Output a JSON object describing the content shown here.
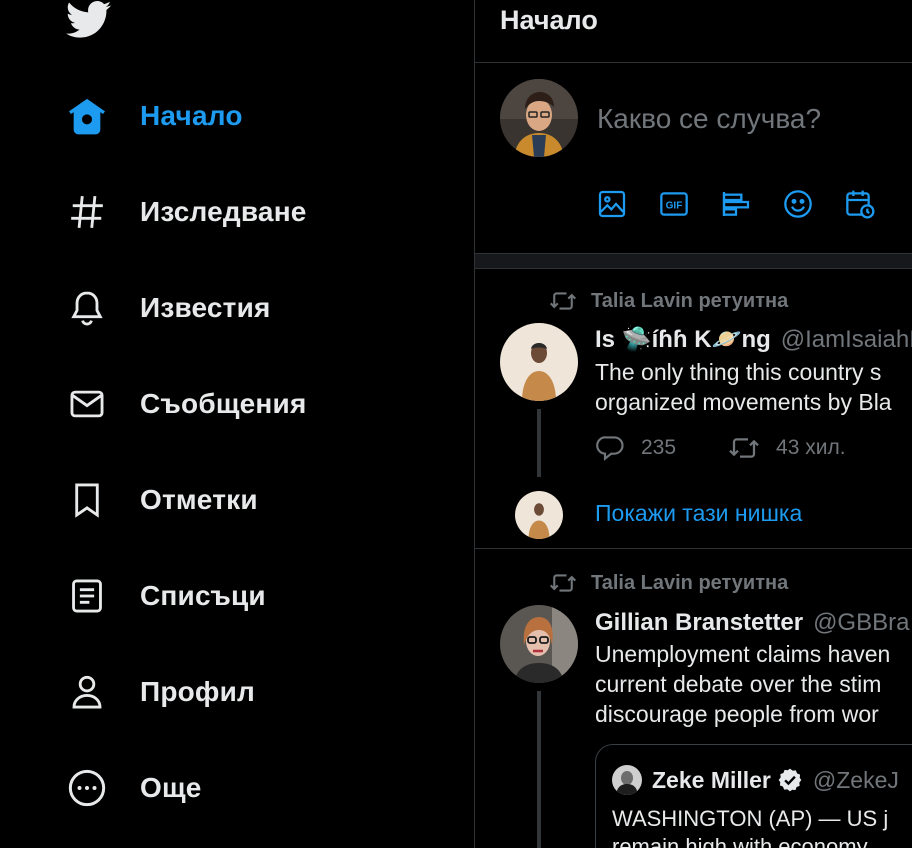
{
  "sidebar": {
    "logo": "twitter-bird-logo",
    "items": [
      {
        "label": "Начало",
        "icon": "home-icon",
        "active": true
      },
      {
        "label": "Изследване",
        "icon": "hashtag-icon"
      },
      {
        "label": "Известия",
        "icon": "bell-icon"
      },
      {
        "label": "Съобщения",
        "icon": "envelope-icon"
      },
      {
        "label": "Отметки",
        "icon": "bookmark-icon"
      },
      {
        "label": "Списъци",
        "icon": "list-icon"
      },
      {
        "label": "Профил",
        "icon": "person-icon"
      },
      {
        "label": "Още",
        "icon": "more-circle-icon"
      }
    ]
  },
  "header": {
    "title": "Начало"
  },
  "compose": {
    "placeholder": "Какво се случва?",
    "tools": [
      "image-icon",
      "gif-icon",
      "poll-icon",
      "emoji-icon",
      "schedule-icon"
    ]
  },
  "tweets": [
    {
      "retweet_text": "Talia Lavin ретуитна",
      "name": "Is 🛸íɦɦ K🪐ng",
      "handle": "@IamIsaiahI",
      "lines": [
        "The only thing this country s",
        "organized movements by Bla"
      ],
      "replies": "235",
      "retweets": "43 хил.",
      "show_thread": "Покажи тази нишка"
    },
    {
      "retweet_text": "Talia Lavin ретуитна",
      "name": "Gillian Branstetter",
      "handle": "@GBBra",
      "lines": [
        "Unemployment claims haven",
        "current debate over the stim",
        "discourage people from wor"
      ],
      "quote": {
        "name": "Zeke Miller",
        "handle": "@ZekeJ",
        "lines": [
          "WASHINGTON (AP) — US j",
          "remain high with economy"
        ]
      }
    }
  ],
  "colors": {
    "accent": "#1d9bf0",
    "background": "#000000",
    "border": "#2f3336",
    "muted": "#71767b",
    "text": "#e7e9ea"
  }
}
